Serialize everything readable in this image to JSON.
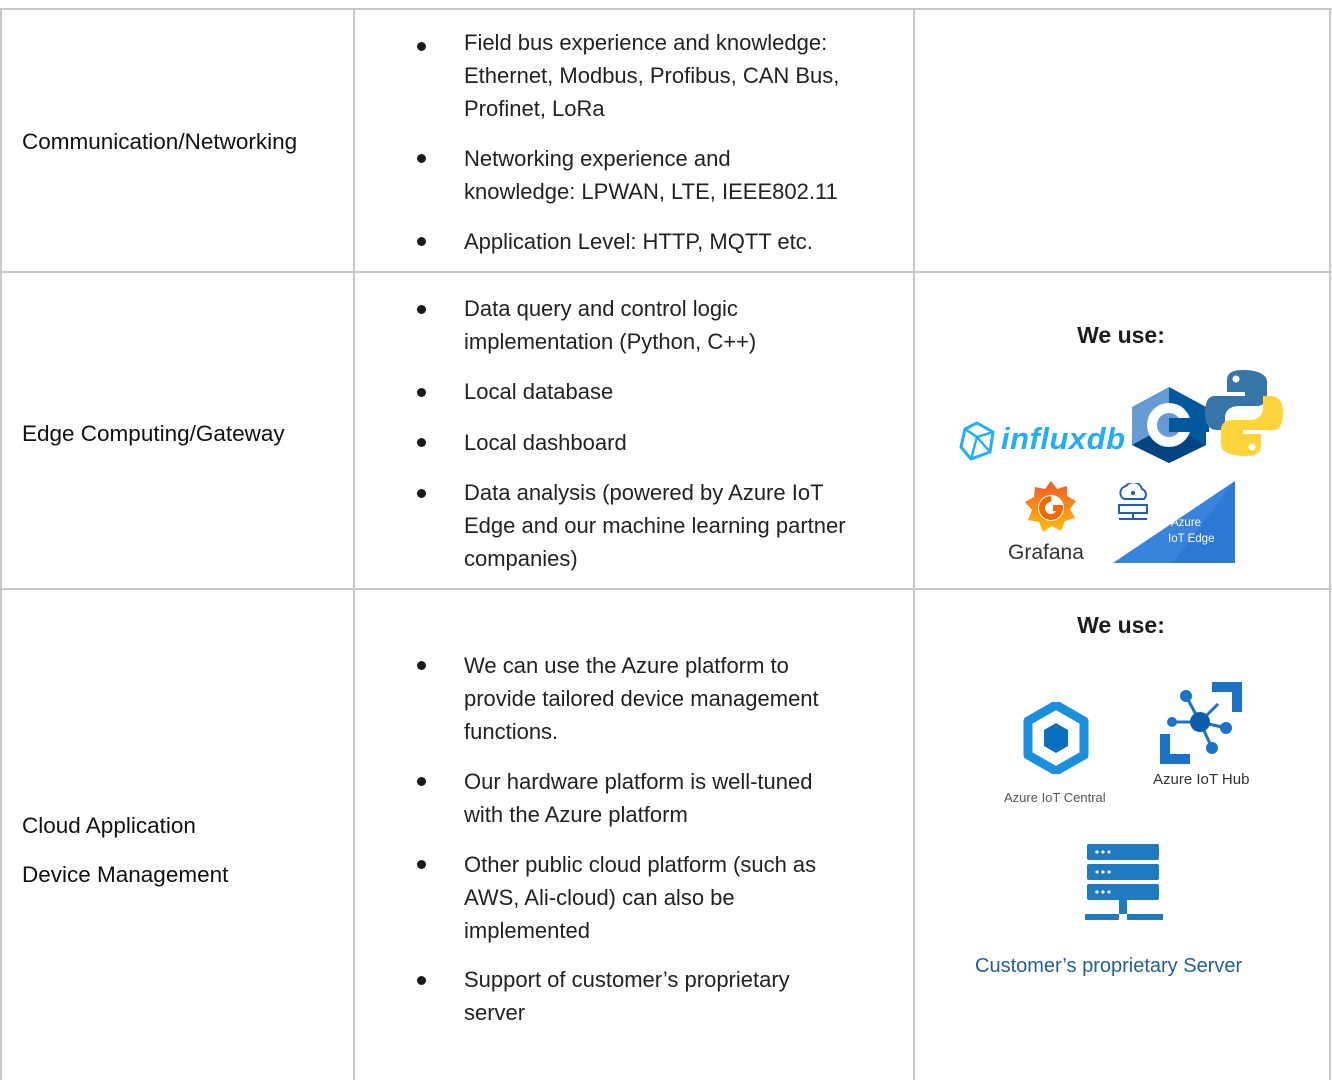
{
  "rows": [
    {
      "label_lines": [
        "Communication/Networking"
      ],
      "bullets": [
        "Field bus experience and knowledge:\nEthernet, Modbus, Profibus, CAN Bus,\nProfinet, LoRa",
        "Networking experience and\nknowledge: LPWAN, LTE, IEEE802.11",
        "Application Level: HTTP, MQTT etc."
      ]
    },
    {
      "label_lines": [
        "Edge Computing/Gateway"
      ],
      "bullets": [
        "Data query and control logic\nimplementation (Python, C++)",
        "Local database",
        "Local dashboard",
        "Data analysis (powered by Azure IoT\nEdge and our machine learning partner\ncompanies)"
      ],
      "we_use": "We use:",
      "logos": {
        "influxdb": "influxdb",
        "grafana": "Grafana",
        "azure_iot_edge_line1": "Azure",
        "azure_iot_edge_line2": "IoT Edge"
      }
    },
    {
      "label_lines": [
        "Cloud Application",
        "Device Management"
      ],
      "bullets": [
        "We can use the Azure platform to\nprovide tailored device management\nfunctions.",
        "Our hardware platform is well-tuned\nwith the Azure platform",
        "Other public cloud platform (such as\nAWS, Ali-cloud) can also be\nimplemented",
        "Support of customer’s proprietary\nserver"
      ],
      "we_use": "We use:",
      "logos": {
        "azure_iot_central": "Azure IoT Central",
        "azure_iot_hub": "Azure IoT Hub",
        "proprietary_server": "Customer’s proprietary Server"
      }
    }
  ],
  "colors": {
    "grid": "#c7c7c7",
    "azure_blue": "#0078d4",
    "link_blue": "#1f5f9e",
    "influx_blue": "#22adf6",
    "grafana_orange": "#f46800"
  }
}
